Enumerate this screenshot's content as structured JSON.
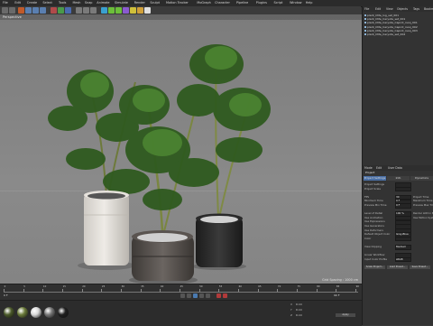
{
  "menu": [
    "File",
    "Edit",
    "Create",
    "Select",
    "Tools",
    "Mesh",
    "Snap",
    "Animate",
    "Simulate",
    "Render",
    "Sculpt",
    "Motion Tracker",
    "MoGraph",
    "Character",
    "Pipeline",
    "Plugins",
    "Script",
    "Window",
    "Help"
  ],
  "viewport": {
    "label": "Perspective",
    "grid_spacing": "Grid Spacing : 1000 cm"
  },
  "right_panel": {
    "tabs": [
      "File",
      "Edit",
      "View",
      "Objects",
      "Tags",
      "Bookmarks"
    ],
    "objects": [
      "plant_CMe_log_set_001",
      "plant_CMe_Caryota_set_001",
      "plant_CMe_Caryota_Caprot_rsoq_001",
      "plant_CMe_Caryota_Caprot_rsoq_002",
      "plant_CMe_Caryota_Caprot_rsoq_003",
      "plant_CMe_Caryota_set_002"
    ],
    "attr_menu": [
      "Mode",
      "Edit",
      "User Data"
    ],
    "attr_title": "Project",
    "attr_tabs": [
      "Project Settings",
      "Info",
      "Dynamics"
    ],
    "props_left": [
      "Project Settings",
      "Project Scale",
      "",
      "FPS",
      "Minimum Time",
      "Preview Min Time",
      "",
      "Level of Detail",
      "Use Animation",
      "Use Expressions",
      "Use Generators",
      "Use Deformers",
      "Default Object Color",
      "Color",
      "",
      "View Clipping",
      "",
      "Linear Workflow",
      "Input Color Profile"
    ],
    "props_right": [
      "",
      "",
      "",
      "Project Time",
      "Maximum Time",
      "Preview Max Time",
      "",
      "Render LOD in Editor",
      "Use Motion System",
      "",
      "",
      "",
      "",
      "",
      "",
      "",
      "",
      "",
      ""
    ],
    "field_values": [
      "30",
      "0 F",
      "0 F",
      "100 %",
      "Gray-Blue",
      "Medium",
      "sRGB"
    ],
    "buttons": [
      "Scale Project...",
      "Load Preset...",
      "Save Preset..."
    ]
  },
  "timeline": {
    "frames": [
      "0",
      "5",
      "10",
      "15",
      "20",
      "25",
      "30",
      "35",
      "40",
      "45",
      "50",
      "55",
      "60",
      "65",
      "70",
      "75",
      "80",
      "85",
      "90"
    ],
    "current": "0 F",
    "end": "90 F"
  },
  "materials": [
    {
      "name": "mat1",
      "color": "#4b5a2a"
    },
    {
      "name": "mat2",
      "color": "#6b7b3a"
    },
    {
      "name": "mat3",
      "color": "#d8d8d8"
    },
    {
      "name": "mat4",
      "color": "#777777"
    },
    {
      "name": "mat5",
      "color": "#202020"
    }
  ],
  "coords": {
    "labels": [
      "X",
      "Y",
      "Z"
    ],
    "values": [
      "0 cm",
      "0 cm",
      "0 cm"
    ],
    "apply": "Apply"
  }
}
